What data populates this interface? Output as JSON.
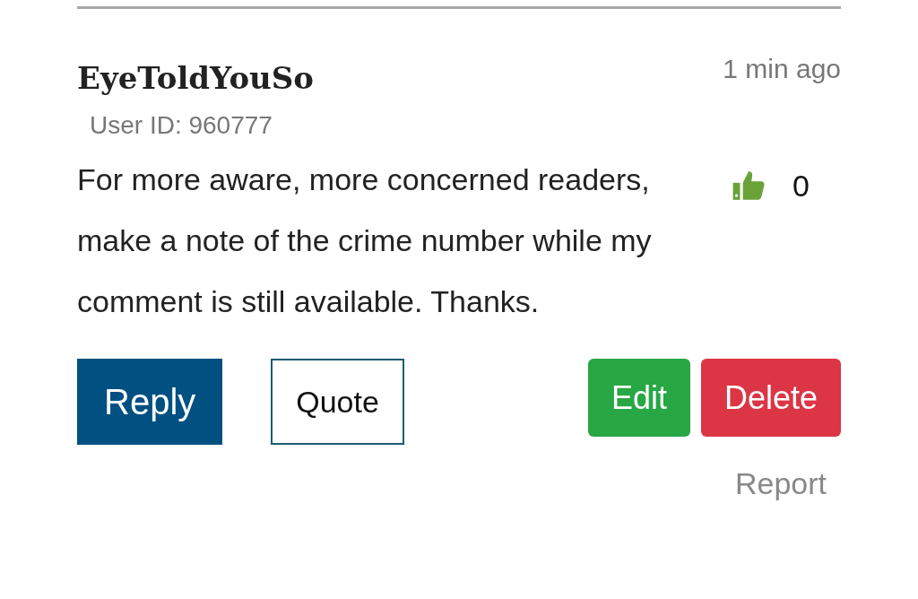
{
  "comment": {
    "author": "EyeToldYouSo",
    "time": "1 min ago",
    "user_id": "User ID: 960777",
    "text": "For more aware, more concerned readers, make a note of the crime number while my comment is still available. Thanks.",
    "likes": "0"
  },
  "buttons": [
    {
      "label": "Reply",
      "kind": "primary"
    },
    {
      "label": "Quote",
      "kind": "outline"
    },
    {
      "label": "Edit",
      "kind": "success"
    },
    {
      "label": "Delete",
      "kind": "danger"
    }
  ],
  "report": "Report"
}
